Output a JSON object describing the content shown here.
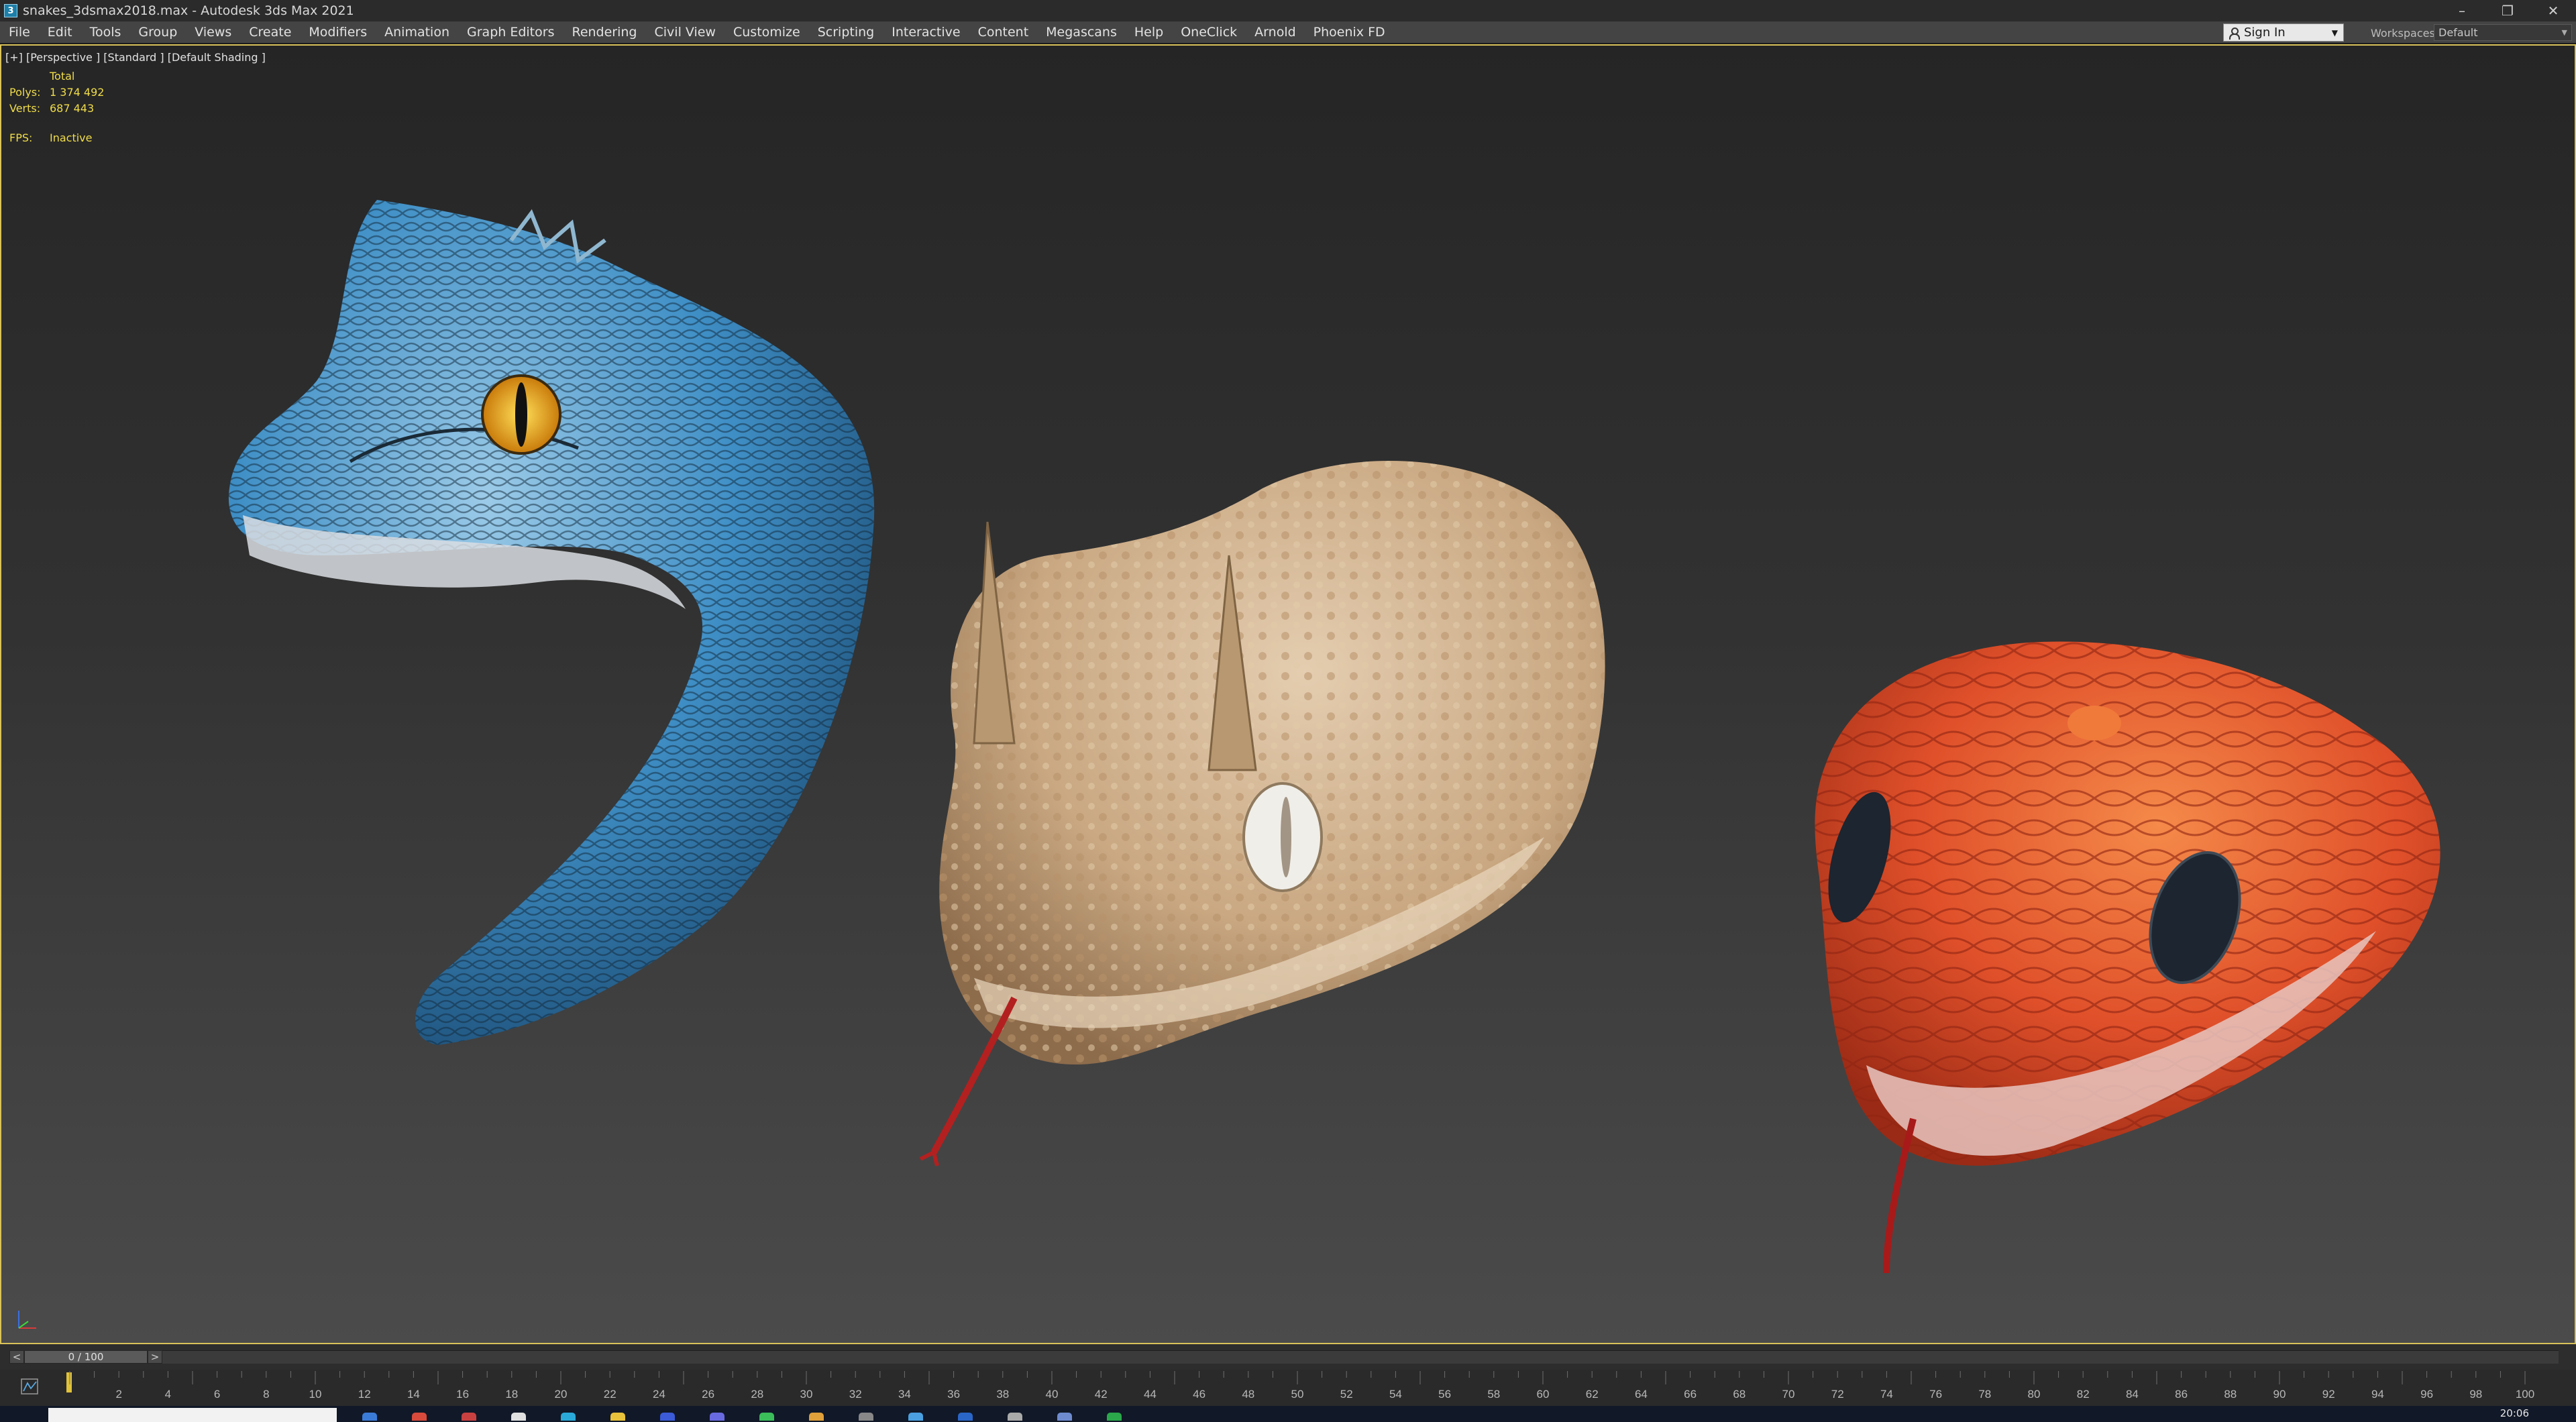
{
  "window": {
    "app_icon_letter": "3",
    "title": "snakes_3dsmax2018.max - Autodesk 3ds Max 2021",
    "minimize_glyph": "–",
    "restore_glyph": "❐",
    "close_glyph": "✕"
  },
  "menu": {
    "items": [
      "File",
      "Edit",
      "Tools",
      "Group",
      "Views",
      "Create",
      "Modifiers",
      "Animation",
      "Graph Editors",
      "Rendering",
      "Civil View",
      "Customize",
      "Scripting",
      "Interactive",
      "Content",
      "Megascans",
      "Help",
      "OneClick",
      "Arnold",
      "Phoenix FD"
    ],
    "sign_in": "Sign In",
    "workspaces_label": "Workspaces:",
    "workspace_value": "Default"
  },
  "viewport": {
    "label": "[+] [Perspective ] [Standard ] [Default Shading ]",
    "stats": {
      "header": "Total",
      "polys_label": "Polys:",
      "polys_value": "1 374 492",
      "verts_label": "Verts:",
      "verts_value": "687 443",
      "fps_label": "FPS:",
      "fps_value": "Inactive"
    },
    "objects": [
      "blue-viper-head-model",
      "horned-viper-head-model",
      "red-snake-head-model"
    ],
    "colors": {
      "blue_snake": "#3f8fc6",
      "sand_snake": "#c9a882",
      "red_snake": "#e0502a",
      "viewport_border": "#d9c25a"
    }
  },
  "timeline": {
    "prev": "<",
    "next": ">",
    "frame_display": "0 / 100",
    "current_frame": 0,
    "start": 0,
    "end": 100,
    "tick_labels": [
      "2",
      "4",
      "6",
      "8",
      "10",
      "12",
      "14",
      "16",
      "18",
      "20",
      "22",
      "24",
      "26",
      "28",
      "30",
      "32",
      "34",
      "36",
      "38",
      "40",
      "42",
      "44",
      "46",
      "48",
      "50",
      "52",
      "54",
      "56",
      "58",
      "60",
      "62",
      "64",
      "66",
      "68",
      "70",
      "72",
      "74",
      "76",
      "78",
      "80",
      "82",
      "84",
      "86",
      "88",
      "90",
      "92",
      "94",
      "96",
      "98",
      "100"
    ]
  },
  "taskbar": {
    "clock": "20:06",
    "icon_colors": [
      "#3b7bd8",
      "#d84a3b",
      "#c94040",
      "#e0e0e0",
      "#2aa9d8",
      "#e8c23a",
      "#3b5bd8",
      "#6a6ae0",
      "#3bbd5a",
      "#e0a03a",
      "#888888",
      "#4aa0e0",
      "#2a66c8",
      "#aaaaaa",
      "#6e8bd0",
      "#2aa84a"
    ]
  }
}
